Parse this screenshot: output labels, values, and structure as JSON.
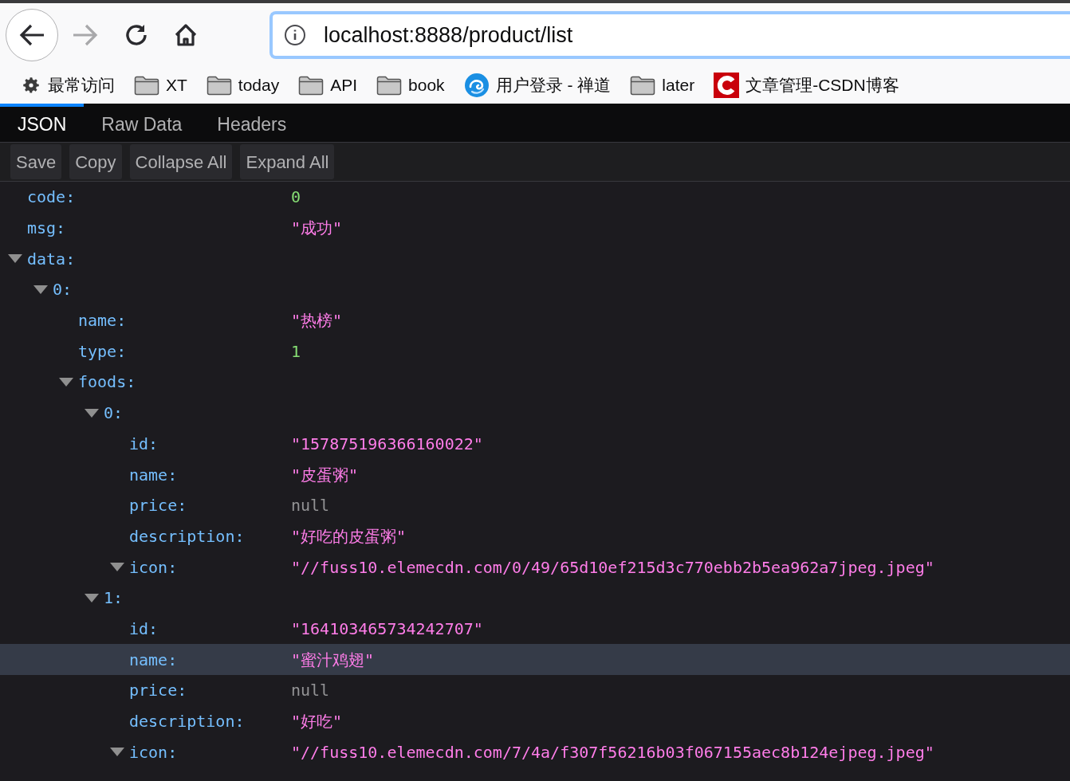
{
  "address_bar": {
    "url": "localhost:8888/product/list"
  },
  "bookmarks": [
    {
      "kind": "settings",
      "label": "最常访问"
    },
    {
      "kind": "folder",
      "label": "XT"
    },
    {
      "kind": "folder",
      "label": "today"
    },
    {
      "kind": "folder",
      "label": "API"
    },
    {
      "kind": "folder",
      "label": "book"
    },
    {
      "kind": "swirl",
      "label": "用户登录 - 禅道"
    },
    {
      "kind": "folder",
      "label": "later"
    },
    {
      "kind": "csdn",
      "label": "文章管理-CSDN博客"
    }
  ],
  "tabs": [
    {
      "label": "JSON",
      "selected": true
    },
    {
      "label": "Raw Data",
      "selected": false
    },
    {
      "label": "Headers",
      "selected": false
    }
  ],
  "toolbar_buttons": [
    "Save",
    "Copy",
    "Collapse All",
    "Expand All"
  ],
  "tree": [
    {
      "key": "code:",
      "value": "0",
      "kind": "number",
      "selected": false
    },
    {
      "key": "msg:",
      "value": "\"成功\"",
      "kind": "string",
      "selected": false
    },
    {
      "key": "data:",
      "expanded": true,
      "selected": false,
      "children": [
        {
          "key": "0:",
          "expanded": true,
          "selected": false,
          "children": [
            {
              "key": "name:",
              "value": "\"热榜\"",
              "kind": "string",
              "selected": false
            },
            {
              "key": "type:",
              "value": "1",
              "kind": "number",
              "selected": false
            },
            {
              "key": "foods:",
              "expanded": true,
              "selected": false,
              "children": [
                {
                  "key": "0:",
                  "expanded": true,
                  "selected": false,
                  "children": [
                    {
                      "key": "id:",
                      "value": "\"157875196366160022\"",
                      "kind": "string",
                      "selected": false
                    },
                    {
                      "key": "name:",
                      "value": "\"皮蛋粥\"",
                      "kind": "string",
                      "selected": false
                    },
                    {
                      "key": "price:",
                      "value": "null",
                      "kind": "null",
                      "selected": false
                    },
                    {
                      "key": "description:",
                      "value": "\"好吃的皮蛋粥\"",
                      "kind": "string",
                      "selected": false
                    },
                    {
                      "key": "icon:",
                      "value": "\"//fuss10.elemecdn.com/0/49/65d10ef215d3c770ebb2b5ea962a7jpeg.jpeg\"",
                      "kind": "string",
                      "expanded": true,
                      "selected": false
                    }
                  ]
                },
                {
                  "key": "1:",
                  "expanded": true,
                  "selected": false,
                  "children": [
                    {
                      "key": "id:",
                      "value": "\"164103465734242707\"",
                      "kind": "string",
                      "selected": false
                    },
                    {
                      "key": "name:",
                      "value": "\"蜜汁鸡翅\"",
                      "kind": "string",
                      "selected": true
                    },
                    {
                      "key": "price:",
                      "value": "null",
                      "kind": "null",
                      "selected": false
                    },
                    {
                      "key": "description:",
                      "value": "\"好吃\"",
                      "kind": "string",
                      "selected": false
                    },
                    {
                      "key": "icon:",
                      "value": "\"//fuss10.elemecdn.com/7/4a/f307f56216b03f067155aec8b124ejpeg.jpeg\"",
                      "kind": "string",
                      "expanded": true,
                      "selected": false
                    }
                  ]
                }
              ]
            }
          ]
        }
      ]
    }
  ]
}
